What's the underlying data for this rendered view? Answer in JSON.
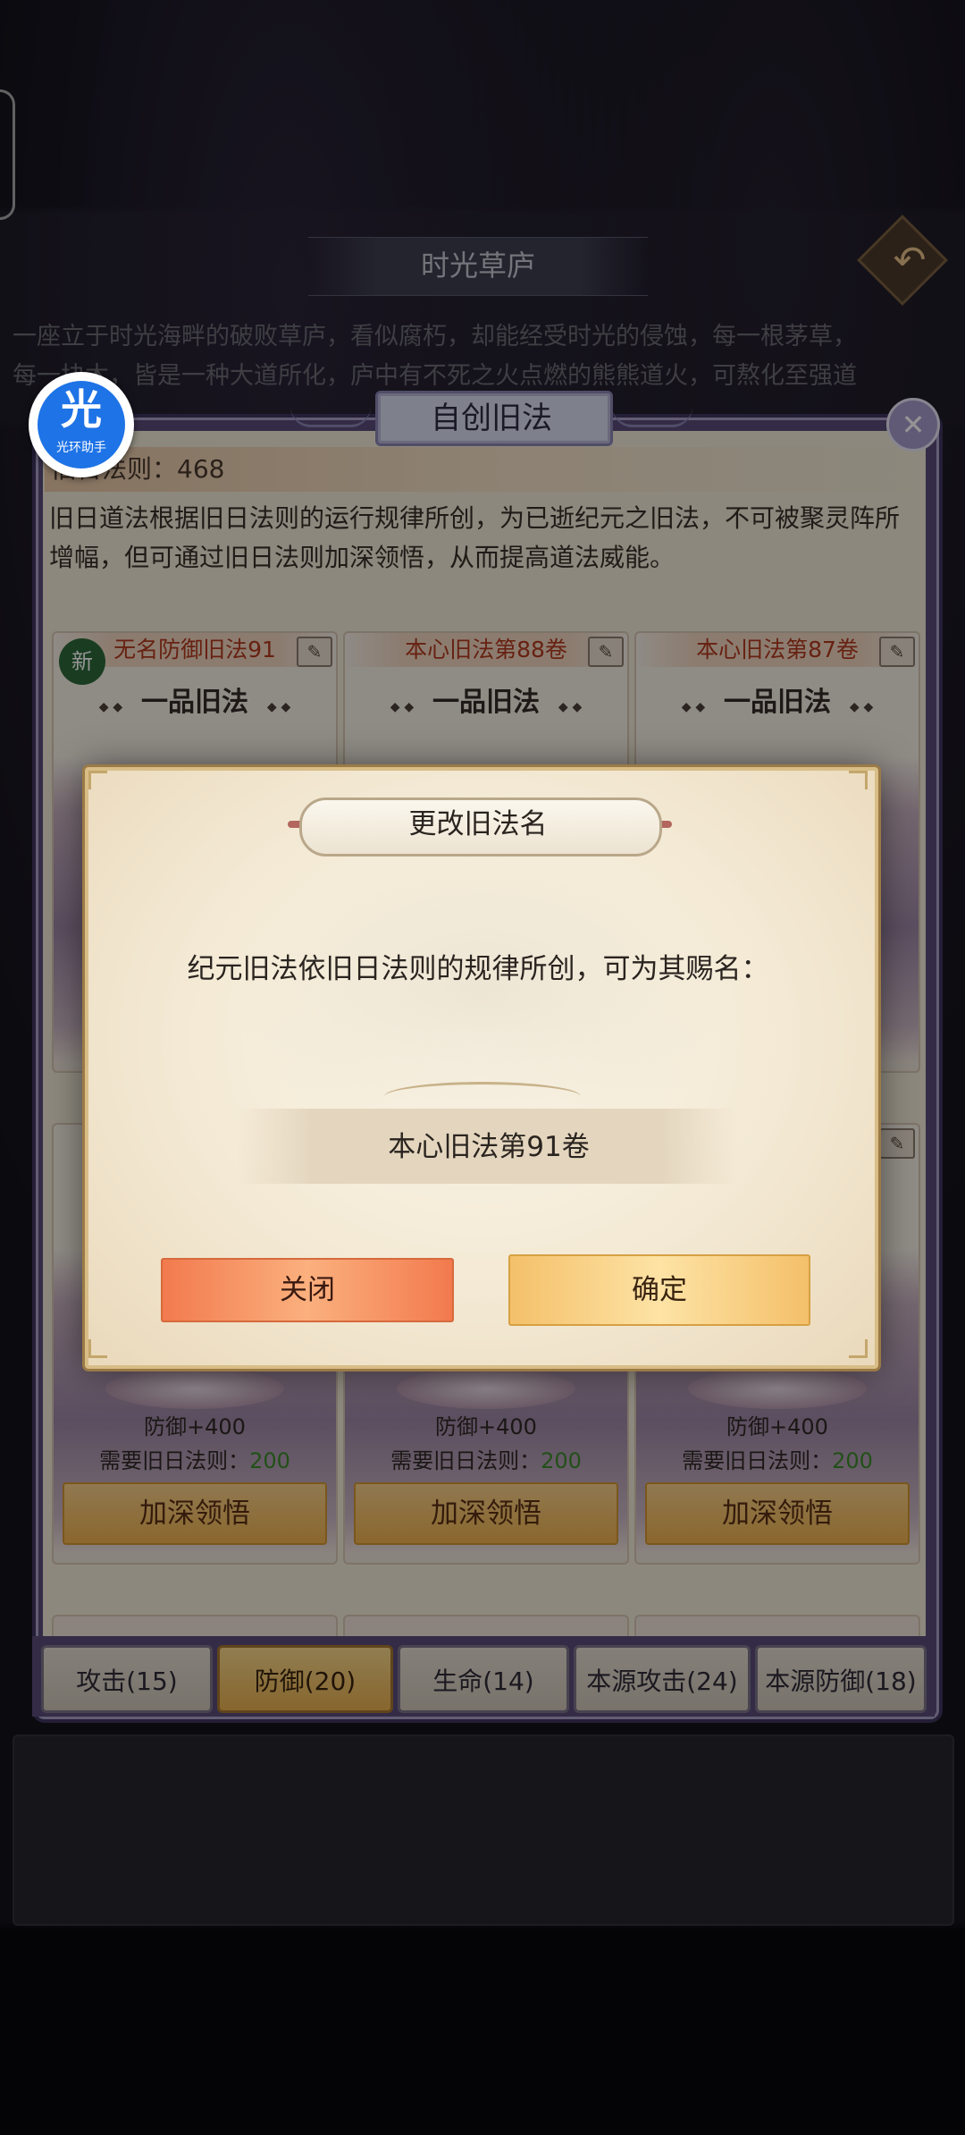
{
  "scene": {
    "title": "时光草庐",
    "description_lines": [
      "一座立于时光海畔的破败草庐，看似腐朽，却能经受时光的侵蚀，每一根茅草，",
      "每一块木，皆是一种大道所化，庐中有不死之火点燃的熊熊道火，可熬化至强道"
    ],
    "back_icon": "back-arrow-icon"
  },
  "panel": {
    "title": "自创旧法",
    "laws_label": "旧日法则：",
    "laws_value": "468",
    "info": "旧日道法根据旧日法则的运行规律所创，为已逝纪元之旧法，不可被聚灵阵所增幅，但可通过旧日法则加深领悟，从而提高道法威能。",
    "close_icon": "close-x-icon"
  },
  "cards_row1": [
    {
      "name": "无名防御旧法91",
      "grade": "一品旧法",
      "badge": "新"
    },
    {
      "name": "本心旧法第88卷",
      "grade": "一品旧法"
    },
    {
      "name": "本心旧法第87卷",
      "grade": "一品旧法"
    }
  ],
  "cards_row2": [
    {
      "effect": "防御+400",
      "req_label": "需要旧日法则：",
      "req_value": "200",
      "button": "加深领悟"
    },
    {
      "effect": "防御+400",
      "req_label": "需要旧日法则：",
      "req_value": "200",
      "button": "加深领悟"
    },
    {
      "effect": "防御+400",
      "req_label": "需要旧日法则：",
      "req_value": "200",
      "button": "加深领悟"
    }
  ],
  "tabs": [
    {
      "label": "攻击(15)",
      "active": false
    },
    {
      "label": "防御(20)",
      "active": true
    },
    {
      "label": "生命(14)",
      "active": false
    },
    {
      "label": "本源攻击(24)",
      "active": false
    },
    {
      "label": "本源防御(18)",
      "active": false
    }
  ],
  "dialog": {
    "title": "更改旧法名",
    "message": "纪元旧法依旧日法则的规律所创，可为其赐名：",
    "name_value": "本心旧法第91卷",
    "close_label": "关闭",
    "confirm_label": "确定"
  },
  "assistant": {
    "glyph": "光",
    "label": "光环助手"
  },
  "colors": {
    "panel_border": "#5b4d7a",
    "button_gold": "#efb24e",
    "button_orange": "#f27a4e",
    "requirement_green": "#3b8a2a",
    "card_title_red": "#b23a1e"
  }
}
